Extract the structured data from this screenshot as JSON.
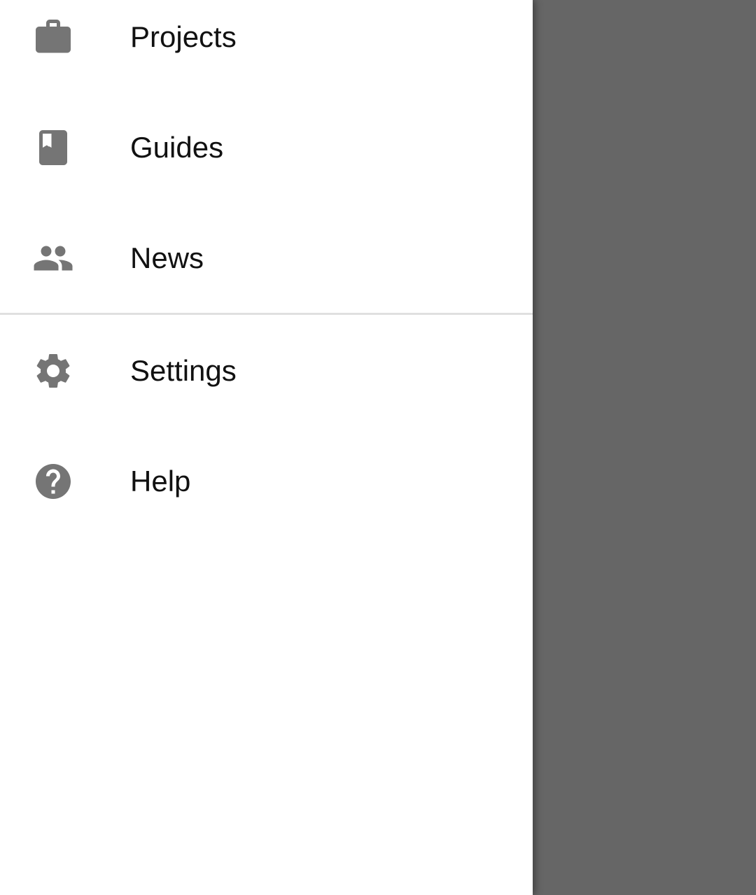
{
  "drawer": {
    "primary_items": [
      {
        "label": "Projects",
        "icon": "briefcase-icon"
      },
      {
        "label": "Guides",
        "icon": "book-icon"
      },
      {
        "label": "News",
        "icon": "people-icon"
      }
    ],
    "secondary_items": [
      {
        "label": "Settings",
        "icon": "gear-icon"
      },
      {
        "label": "Help",
        "icon": "help-circle-icon"
      }
    ]
  },
  "colors": {
    "icon": "#757575",
    "text": "#111111",
    "scrim": "#666666",
    "divider": "#e0e0e0",
    "drawer_background": "#ffffff"
  }
}
